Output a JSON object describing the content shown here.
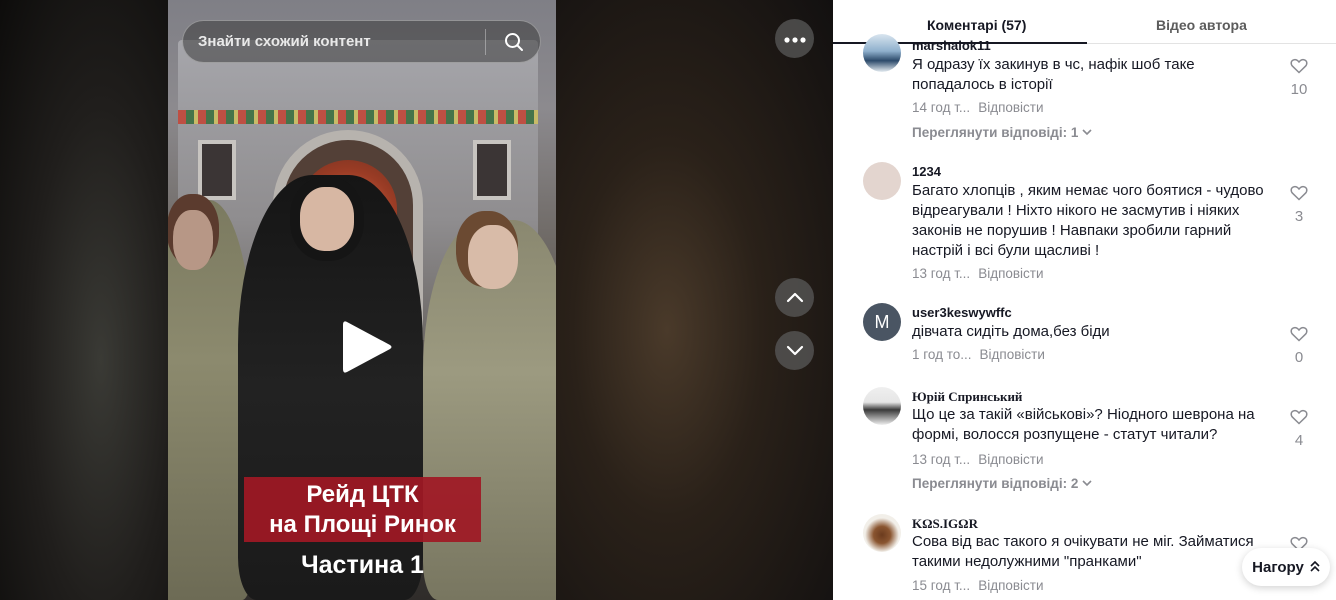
{
  "search": {
    "placeholder": "Знайти схожий контент",
    "icon": "search-icon"
  },
  "video": {
    "caption_line1": "Рейд ЦТК",
    "caption_line2": "на Площі Ринок",
    "caption_part": "Частина 1",
    "more_icon": "more-horizontal-icon",
    "play_icon": "play-icon"
  },
  "navigation": {
    "up_icon": "chevron-up-icon",
    "down_icon": "chevron-down-icon"
  },
  "tabs": [
    {
      "label": "Коментарі (57)",
      "active": true
    },
    {
      "label": "Відео автора",
      "active": false
    }
  ],
  "comments": [
    {
      "username": "marshalok11",
      "text": "Я одразу їх закинув в чс, нафік шоб таке попадалось в історії",
      "time": "14 год т...",
      "reply": "Відповісти",
      "likes": "10",
      "view_replies": "Переглянути відповіді: 1"
    },
    {
      "username": "1234",
      "text": "Багато хлопців , яким немає чого боятися - чудово відреагували ! Ніхто нікого не засмутив і ніяких законів не порушив ! Навпаки зробили гарний настрій і всі були щасливі !",
      "time": "13 год т...",
      "reply": "Відповісти",
      "likes": "3"
    },
    {
      "username": "user3keswywffc",
      "avatar_letter": "M",
      "text": "дівчата сидіть дома,без біди",
      "time": "1 год то...",
      "reply": "Відповісти",
      "likes": "0"
    },
    {
      "username": "Юрій Спринський",
      "text": "Що це за такій «військові»? Ніодного шеврона на формі, волосся розпущене - статут читали?",
      "time": "13 год т...",
      "reply": "Відповісти",
      "likes": "4",
      "view_replies": "Переглянути відповіді: 2"
    },
    {
      "username": "ΚΩS.IGΩR",
      "text": "Сова від вас такого я очікувати не міг. Займатися такими недолужними \"пранками\"",
      "time": "15 год т...",
      "reply": "Відповісти"
    }
  ],
  "top_button": {
    "label": "Нагору",
    "icon": "double-chevron-up-icon"
  },
  "colors": {
    "caption_bg": "#a01824",
    "text_primary": "#161823",
    "text_secondary": "#8a8b91"
  }
}
